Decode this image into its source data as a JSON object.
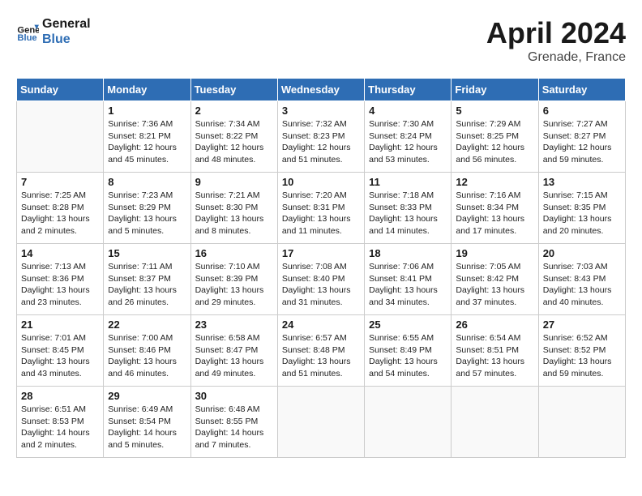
{
  "header": {
    "logo_line1": "General",
    "logo_line2": "Blue",
    "month_year": "April 2024",
    "location": "Grenade, France"
  },
  "days_of_week": [
    "Sunday",
    "Monday",
    "Tuesday",
    "Wednesday",
    "Thursday",
    "Friday",
    "Saturday"
  ],
  "weeks": [
    [
      {
        "day": "",
        "info": ""
      },
      {
        "day": "1",
        "info": "Sunrise: 7:36 AM\nSunset: 8:21 PM\nDaylight: 12 hours\nand 45 minutes."
      },
      {
        "day": "2",
        "info": "Sunrise: 7:34 AM\nSunset: 8:22 PM\nDaylight: 12 hours\nand 48 minutes."
      },
      {
        "day": "3",
        "info": "Sunrise: 7:32 AM\nSunset: 8:23 PM\nDaylight: 12 hours\nand 51 minutes."
      },
      {
        "day": "4",
        "info": "Sunrise: 7:30 AM\nSunset: 8:24 PM\nDaylight: 12 hours\nand 53 minutes."
      },
      {
        "day": "5",
        "info": "Sunrise: 7:29 AM\nSunset: 8:25 PM\nDaylight: 12 hours\nand 56 minutes."
      },
      {
        "day": "6",
        "info": "Sunrise: 7:27 AM\nSunset: 8:27 PM\nDaylight: 12 hours\nand 59 minutes."
      }
    ],
    [
      {
        "day": "7",
        "info": "Sunrise: 7:25 AM\nSunset: 8:28 PM\nDaylight: 13 hours\nand 2 minutes."
      },
      {
        "day": "8",
        "info": "Sunrise: 7:23 AM\nSunset: 8:29 PM\nDaylight: 13 hours\nand 5 minutes."
      },
      {
        "day": "9",
        "info": "Sunrise: 7:21 AM\nSunset: 8:30 PM\nDaylight: 13 hours\nand 8 minutes."
      },
      {
        "day": "10",
        "info": "Sunrise: 7:20 AM\nSunset: 8:31 PM\nDaylight: 13 hours\nand 11 minutes."
      },
      {
        "day": "11",
        "info": "Sunrise: 7:18 AM\nSunset: 8:33 PM\nDaylight: 13 hours\nand 14 minutes."
      },
      {
        "day": "12",
        "info": "Sunrise: 7:16 AM\nSunset: 8:34 PM\nDaylight: 13 hours\nand 17 minutes."
      },
      {
        "day": "13",
        "info": "Sunrise: 7:15 AM\nSunset: 8:35 PM\nDaylight: 13 hours\nand 20 minutes."
      }
    ],
    [
      {
        "day": "14",
        "info": "Sunrise: 7:13 AM\nSunset: 8:36 PM\nDaylight: 13 hours\nand 23 minutes."
      },
      {
        "day": "15",
        "info": "Sunrise: 7:11 AM\nSunset: 8:37 PM\nDaylight: 13 hours\nand 26 minutes."
      },
      {
        "day": "16",
        "info": "Sunrise: 7:10 AM\nSunset: 8:39 PM\nDaylight: 13 hours\nand 29 minutes."
      },
      {
        "day": "17",
        "info": "Sunrise: 7:08 AM\nSunset: 8:40 PM\nDaylight: 13 hours\nand 31 minutes."
      },
      {
        "day": "18",
        "info": "Sunrise: 7:06 AM\nSunset: 8:41 PM\nDaylight: 13 hours\nand 34 minutes."
      },
      {
        "day": "19",
        "info": "Sunrise: 7:05 AM\nSunset: 8:42 PM\nDaylight: 13 hours\nand 37 minutes."
      },
      {
        "day": "20",
        "info": "Sunrise: 7:03 AM\nSunset: 8:43 PM\nDaylight: 13 hours\nand 40 minutes."
      }
    ],
    [
      {
        "day": "21",
        "info": "Sunrise: 7:01 AM\nSunset: 8:45 PM\nDaylight: 13 hours\nand 43 minutes."
      },
      {
        "day": "22",
        "info": "Sunrise: 7:00 AM\nSunset: 8:46 PM\nDaylight: 13 hours\nand 46 minutes."
      },
      {
        "day": "23",
        "info": "Sunrise: 6:58 AM\nSunset: 8:47 PM\nDaylight: 13 hours\nand 49 minutes."
      },
      {
        "day": "24",
        "info": "Sunrise: 6:57 AM\nSunset: 8:48 PM\nDaylight: 13 hours\nand 51 minutes."
      },
      {
        "day": "25",
        "info": "Sunrise: 6:55 AM\nSunset: 8:49 PM\nDaylight: 13 hours\nand 54 minutes."
      },
      {
        "day": "26",
        "info": "Sunrise: 6:54 AM\nSunset: 8:51 PM\nDaylight: 13 hours\nand 57 minutes."
      },
      {
        "day": "27",
        "info": "Sunrise: 6:52 AM\nSunset: 8:52 PM\nDaylight: 13 hours\nand 59 minutes."
      }
    ],
    [
      {
        "day": "28",
        "info": "Sunrise: 6:51 AM\nSunset: 8:53 PM\nDaylight: 14 hours\nand 2 minutes."
      },
      {
        "day": "29",
        "info": "Sunrise: 6:49 AM\nSunset: 8:54 PM\nDaylight: 14 hours\nand 5 minutes."
      },
      {
        "day": "30",
        "info": "Sunrise: 6:48 AM\nSunset: 8:55 PM\nDaylight: 14 hours\nand 7 minutes."
      },
      {
        "day": "",
        "info": ""
      },
      {
        "day": "",
        "info": ""
      },
      {
        "day": "",
        "info": ""
      },
      {
        "day": "",
        "info": ""
      }
    ]
  ]
}
